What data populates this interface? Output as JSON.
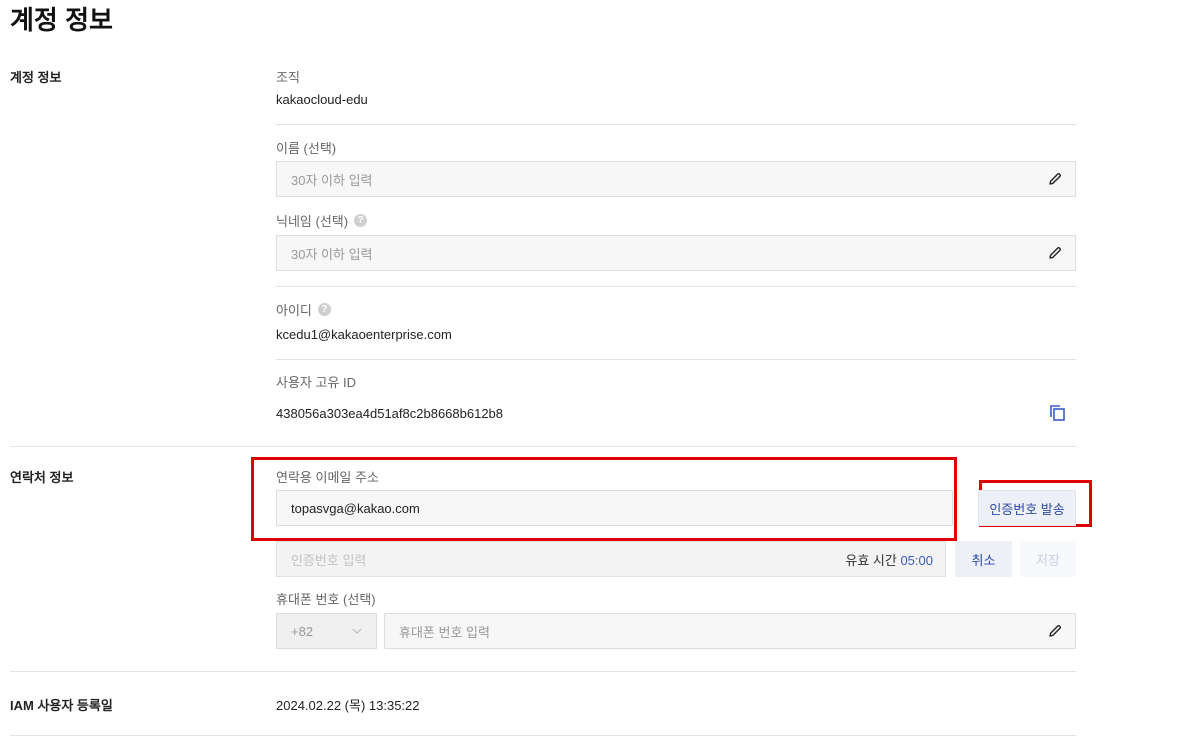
{
  "page": {
    "title": "계정 정보"
  },
  "account": {
    "section_label": "계정 정보",
    "org_label": "조직",
    "org_value": "kakaocloud-edu",
    "name_label": "이름 (선택)",
    "name_placeholder": "30자 이하 입력",
    "nickname_label": "닉네임 (선택)",
    "nickname_placeholder": "30자 이하 입력",
    "id_label": "아이디",
    "id_value": "kcedu1@kakaoenterprise.com",
    "uid_label": "사용자 고유 ID",
    "uid_value": "438056a303ea4d51af8c2b8668b612b8"
  },
  "contact": {
    "section_label": "연락처 정보",
    "email_label": "연락용 이메일 주소",
    "email_value": "topasvga@kakao.com",
    "send_code_label": "인증번호 발송",
    "code_placeholder": "인증번호 입력",
    "timer_label": "유효 시간",
    "timer_value": "05:00",
    "cancel_label": "취소",
    "save_label": "저장",
    "phone_label": "휴대폰 번호 (선택)",
    "country_code": "+82",
    "phone_placeholder": "휴대폰 번호 입력"
  },
  "registration": {
    "section_label": "IAM 사용자 등록일",
    "date_value": "2024.02.22 (목) 13:35:22"
  },
  "icons": {
    "help": "?",
    "edit": "pencil-icon",
    "copy": "copy-icon",
    "dropdown": "chevron-down-icon"
  },
  "colors": {
    "accent": "#2c4aa8",
    "highlight": "#e00000"
  }
}
